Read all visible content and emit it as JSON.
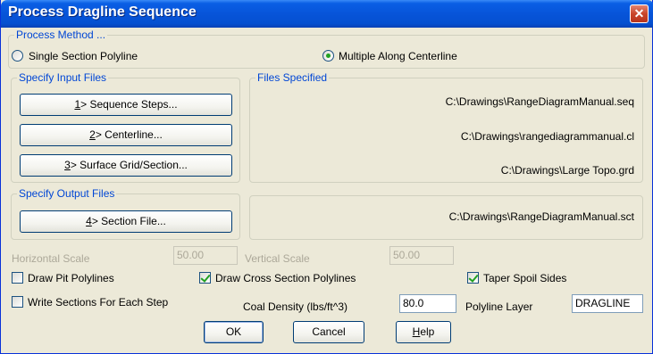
{
  "window": {
    "title": "Process Dragline Sequence",
    "close_glyph": "✕"
  },
  "process_method": {
    "label": "Process Method ...",
    "single_label": "Single Section Polyline",
    "multiple_label": "Multiple Along Centerline",
    "selected": "multiple"
  },
  "input_files": {
    "label": "Specify Input Files",
    "seq_key": "1",
    "seq_label": "> Sequence Steps...",
    "cl_key": "2",
    "cl_label": "> Centerline...",
    "grid_key": "3",
    "grid_label": "> Surface Grid/Section..."
  },
  "files_specified": {
    "label": "Files Specified",
    "seq_path": "C:\\Drawings\\RangeDiagramManual.seq",
    "cl_path": "C:\\Drawings\\rangediagrammanual.cl",
    "grid_path": "C:\\Drawings\\Large Topo.grd"
  },
  "output_files": {
    "label": "Specify Output Files",
    "section_key": "4",
    "section_label": "> Section File...",
    "section_path": "C:\\Drawings\\RangeDiagramManual.sct"
  },
  "scales": {
    "horizontal_label": "Horizontal Scale",
    "horizontal_value": "50.00",
    "vertical_label": "Vertical Scale",
    "vertical_value": "50.00"
  },
  "options": {
    "draw_pit_label": "Draw Pit Polylines",
    "draw_pit_checked": false,
    "draw_cross_label": "Draw Cross Section Polylines",
    "draw_cross_checked": true,
    "taper_label": "Taper Spoil Sides",
    "taper_checked": true,
    "write_sections_label": "Write Sections For Each Step",
    "write_sections_checked": false
  },
  "coal_density": {
    "label": "Coal Density (lbs/ft^3)",
    "value": "80.0"
  },
  "polyline_layer": {
    "label": "Polyline Layer",
    "value": "DRAGLINE"
  },
  "buttons": {
    "ok": "OK",
    "cancel": "Cancel",
    "help_key": "H",
    "help_rest": "elp"
  }
}
